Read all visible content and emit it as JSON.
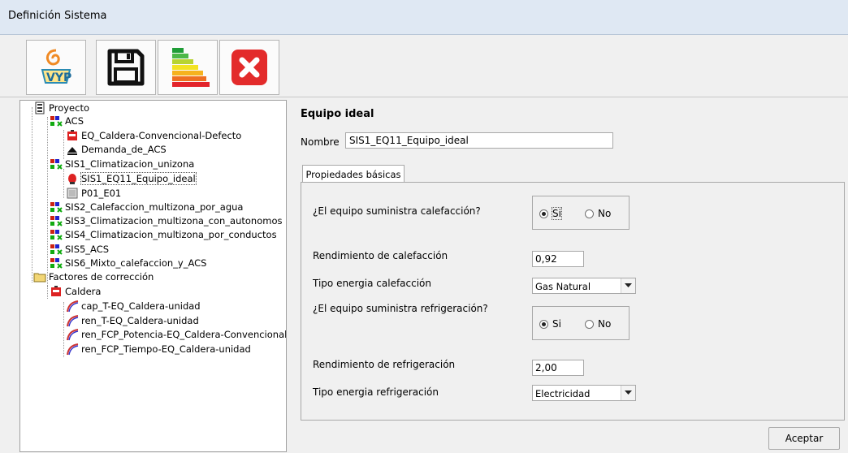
{
  "window": {
    "title": "Definición Sistema"
  },
  "toolbar": {
    "buttons": [
      {
        "name": "vyp-logo-button",
        "icon": "vyp-logo-icon"
      },
      {
        "name": "save-button",
        "icon": "save-icon"
      },
      {
        "name": "energy-rating-button",
        "icon": "energy-rating-icon"
      },
      {
        "name": "close-button",
        "icon": "close-icon"
      }
    ]
  },
  "tree": {
    "items": [
      {
        "label": "Proyecto",
        "icon": "project-icon",
        "level": 0
      },
      {
        "label": "ACS",
        "icon": "system-icon",
        "level": 1
      },
      {
        "label": "EQ_Caldera-Convencional-Defecto",
        "icon": "boiler-icon",
        "level": 2
      },
      {
        "label": "Demanda_de_ACS",
        "icon": "demand-icon",
        "level": 2
      },
      {
        "label": "SIS1_Climatizacion_unizona",
        "icon": "system-icon",
        "level": 1
      },
      {
        "label": "SIS1_EQ11_Equipo_ideal",
        "icon": "ideal-equipment-icon",
        "level": 2,
        "selected": true
      },
      {
        "label": "P01_E01",
        "icon": "space-icon",
        "level": 2
      },
      {
        "label": "SIS2_Calefaccion_multizona_por_agua",
        "icon": "system-icon",
        "level": 1
      },
      {
        "label": "SIS3_Climatizacion_multizona_con_autonomos",
        "icon": "system-icon",
        "level": 1
      },
      {
        "label": "SIS4_Climatizacion_multizona_por_conductos",
        "icon": "system-icon",
        "level": 1
      },
      {
        "label": "SIS5_ACS",
        "icon": "system-icon",
        "level": 1
      },
      {
        "label": "SIS6_Mixto_calefaccion_y_ACS",
        "icon": "system-icon",
        "level": 1
      },
      {
        "label": "Factores de corrección",
        "icon": "folder-icon",
        "level": 0
      },
      {
        "label": "Caldera",
        "icon": "boiler-icon",
        "level": 1
      },
      {
        "label": "cap_T-EQ_Caldera-unidad",
        "icon": "curve-icon",
        "level": 2
      },
      {
        "label": "ren_T-EQ_Caldera-unidad",
        "icon": "curve-icon",
        "level": 2
      },
      {
        "label": "ren_FCP_Potencia-EQ_Caldera-Convencional-",
        "icon": "curve-icon",
        "level": 2
      },
      {
        "label": "ren_FCP_Tiempo-EQ_Caldera-unidad",
        "icon": "curve-icon",
        "level": 2
      }
    ]
  },
  "detail": {
    "title": "Equipo ideal",
    "name_label": "Nombre",
    "name_value": "SIS1_EQ11_Equipo_ideal",
    "tab_label": "Propiedades básicas",
    "heating_question": "¿El equipo suministra calefacción?",
    "heating_yes": "Si",
    "heating_no": "No",
    "heating_efficiency_label": "Rendimiento de calefacción",
    "heating_efficiency_value": "0,92",
    "heating_energy_label": "Tipo energia calefacción",
    "heating_energy_value": "Gas Natural",
    "cooling_question": "¿El equipo suministra refrigeración?",
    "cooling_yes": "Si",
    "cooling_no": "No",
    "cooling_efficiency_label": "Rendimiento de refrigeración",
    "cooling_efficiency_value": "2,00",
    "cooling_energy_label": "Tipo energia refrigeración",
    "cooling_energy_value": "Electricidad",
    "accept_label": "Aceptar"
  }
}
